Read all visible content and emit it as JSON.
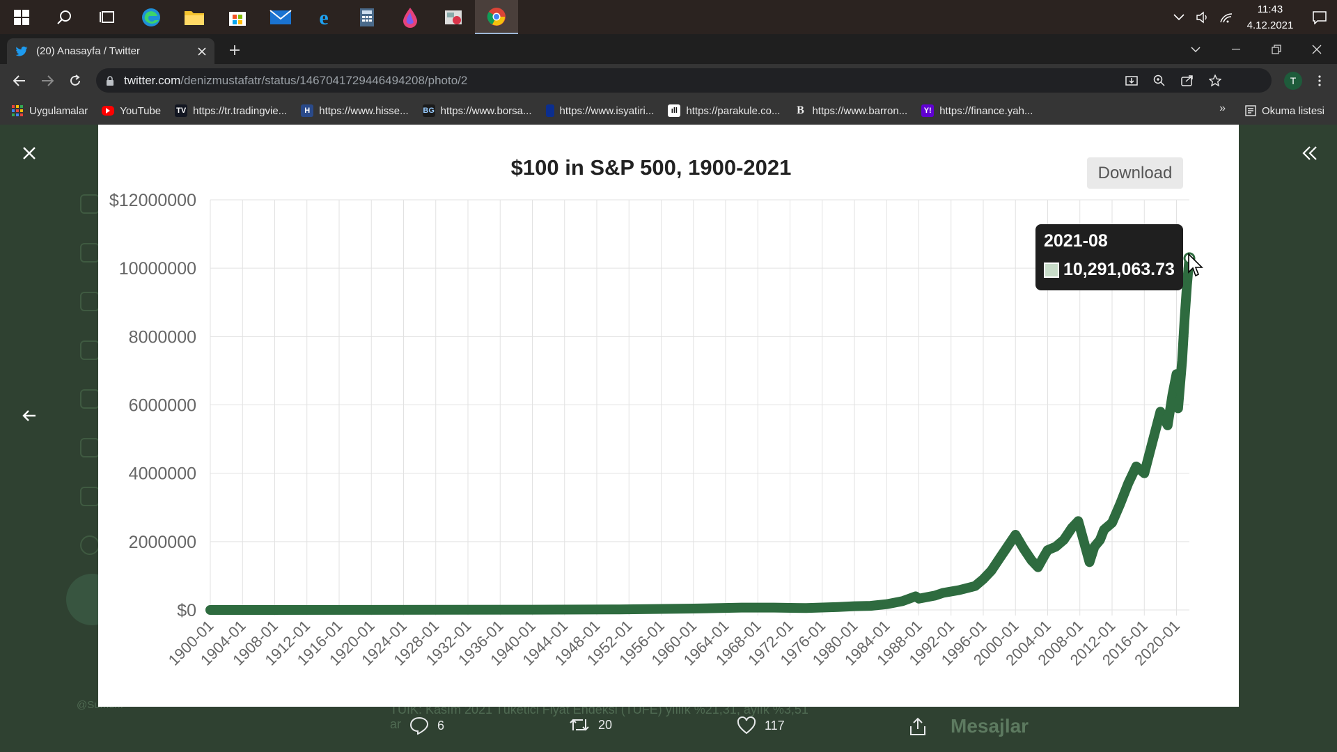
{
  "taskbar": {
    "apps": [
      {
        "name": "start",
        "icon": "windows-logo-icon"
      },
      {
        "name": "search",
        "icon": "search-icon"
      },
      {
        "name": "task-view",
        "icon": "task-view-icon"
      },
      {
        "name": "edge",
        "icon": "edge-icon"
      },
      {
        "name": "file-explorer",
        "icon": "folder-icon"
      },
      {
        "name": "store",
        "icon": "store-icon"
      },
      {
        "name": "mail",
        "icon": "mail-icon"
      },
      {
        "name": "internet-explorer",
        "icon": "ie-icon"
      },
      {
        "name": "calculator",
        "icon": "calculator-icon"
      },
      {
        "name": "paint",
        "icon": "paint-drop-icon"
      },
      {
        "name": "snipping",
        "icon": "snip-icon"
      },
      {
        "name": "chrome",
        "icon": "chrome-icon"
      }
    ],
    "clock": {
      "time": "11:43",
      "date": "4.12.2021"
    }
  },
  "browser": {
    "tab_title": "(20) Anasayfa / Twitter",
    "url_host": "twitter.com",
    "url_path": "/denizmustafatr/status/1467041729446494208/photo/2",
    "profile_initial": "T",
    "bookmarks": [
      {
        "label": "Uygulamalar",
        "icon": "apps-grid-icon",
        "color": "#e8453c"
      },
      {
        "label": "YouTube",
        "icon": "youtube-icon",
        "color": "#ff0000"
      },
      {
        "label": "https://tr.tradingvie...",
        "icon": "tradingview-icon",
        "color": "#131722"
      },
      {
        "label": "https://www.hisse...",
        "icon": "hisse-icon",
        "color": "#2a4a8a"
      },
      {
        "label": "https://www.borsa...",
        "icon": "borsa-icon",
        "color": "#1b1b1b"
      },
      {
        "label": "https://www.isyatiri...",
        "icon": "isyatirim-icon",
        "color": "#0b2e8f"
      },
      {
        "label": "https://parakule.co...",
        "icon": "parakule-icon",
        "color": "#111111"
      },
      {
        "label": "https://www.barron...",
        "icon": "barrons-icon",
        "color": "#333333"
      },
      {
        "label": "https://finance.yah...",
        "icon": "yahoo-icon",
        "color": "#6001d2"
      }
    ],
    "bookmarks_more": "»",
    "reading_list": "Okuma listesi"
  },
  "background": {
    "tweet_text": "TÜİK: Kasım 2021 Tüketici Fiyat Endeksi (TÜFE) yıllık %21,31, aylık %3,51",
    "tweet_text_line2": "ar",
    "user_handle": "@Sumer..",
    "messages_label": "Mesajlar"
  },
  "photo": {
    "download_label": "Download",
    "tooltip": {
      "date": "2021-08",
      "value": "10,291,063.73"
    }
  },
  "chart_data": {
    "type": "line",
    "title": "$100 in S&P 500, 1900-2021",
    "xlabel": "",
    "ylabel": "",
    "ylim": [
      0,
      12000000
    ],
    "yticks": [
      "$0",
      "2000000",
      "4000000",
      "6000000",
      "8000000",
      "10000000",
      "$12000000"
    ],
    "ytick_values": [
      0,
      2000000,
      4000000,
      6000000,
      8000000,
      10000000,
      12000000
    ],
    "xlim": [
      1900,
      2021.6
    ],
    "xticks": [
      "1900-01",
      "1904-01",
      "1908-01",
      "1912-01",
      "1916-01",
      "1920-01",
      "1924-01",
      "1928-01",
      "1932-01",
      "1936-01",
      "1940-01",
      "1944-01",
      "1948-01",
      "1952-01",
      "1956-01",
      "1960-01",
      "1964-01",
      "1968-01",
      "1972-01",
      "1976-01",
      "1980-01",
      "1984-01",
      "1988-01",
      "1992-01",
      "1996-01",
      "2000-01",
      "2004-01",
      "2008-01",
      "2012-01",
      "2016-01",
      "2020-01"
    ],
    "grid": true,
    "line_color": "#2e6b3f",
    "series": [
      {
        "points": [
          [
            1900,
            0
          ],
          [
            1920,
            1500
          ],
          [
            1940,
            8000
          ],
          [
            1950,
            14000
          ],
          [
            1960,
            40000
          ],
          [
            1966,
            70000
          ],
          [
            1970,
            70000
          ],
          [
            1974,
            55000
          ],
          [
            1978,
            85000
          ],
          [
            1980,
            110000
          ],
          [
            1982,
            120000
          ],
          [
            1984,
            170000
          ],
          [
            1986,
            260000
          ],
          [
            1987.6,
            400000
          ],
          [
            1988,
            330000
          ],
          [
            1990,
            420000
          ],
          [
            1991,
            500000
          ],
          [
            1993,
            580000
          ],
          [
            1995,
            700000
          ],
          [
            1996,
            900000
          ],
          [
            1997,
            1150000
          ],
          [
            1998,
            1500000
          ],
          [
            1999,
            1850000
          ],
          [
            2000,
            2200000
          ],
          [
            2001,
            1800000
          ],
          [
            2002,
            1450000
          ],
          [
            2002.8,
            1250000
          ],
          [
            2003.5,
            1550000
          ],
          [
            2004,
            1750000
          ],
          [
            2005,
            1850000
          ],
          [
            2006,
            2050000
          ],
          [
            2007,
            2400000
          ],
          [
            2007.8,
            2600000
          ],
          [
            2008.5,
            2000000
          ],
          [
            2009.2,
            1400000
          ],
          [
            2009.8,
            1850000
          ],
          [
            2010.5,
            2050000
          ],
          [
            2011,
            2350000
          ],
          [
            2012,
            2550000
          ],
          [
            2013,
            3100000
          ],
          [
            2014,
            3700000
          ],
          [
            2015,
            4200000
          ],
          [
            2016,
            4000000
          ],
          [
            2017,
            4900000
          ],
          [
            2018,
            5800000
          ],
          [
            2018.9,
            5400000
          ],
          [
            2019.5,
            6300000
          ],
          [
            2020,
            6900000
          ],
          [
            2020.2,
            5900000
          ],
          [
            2020.7,
            7300000
          ],
          [
            2021,
            8500000
          ],
          [
            2021.3,
            9500000
          ],
          [
            2021.6,
            10291063.73
          ]
        ]
      }
    ]
  },
  "actions": {
    "reply_count": "6",
    "retweet_count": "20",
    "like_count": "117"
  }
}
